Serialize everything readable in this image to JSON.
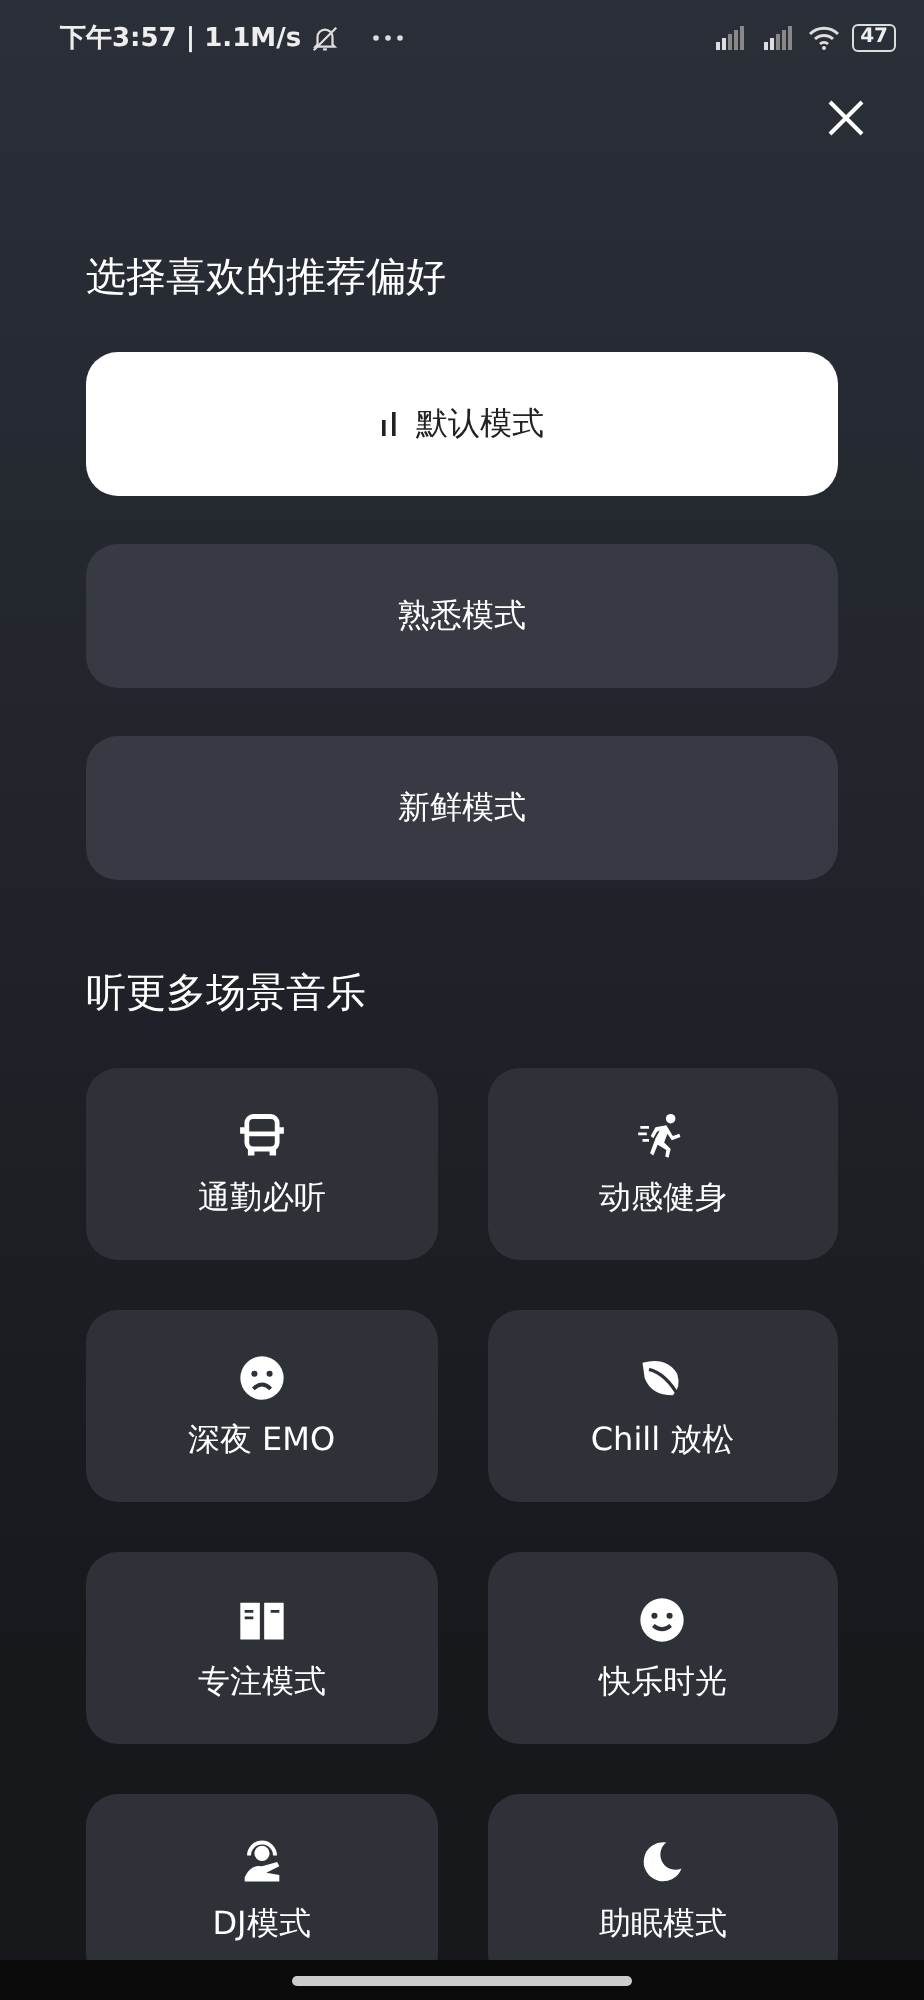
{
  "status_bar": {
    "time": "下午3:57 | 1.1M/s",
    "battery": "47"
  },
  "preference": {
    "title": "选择喜欢的推荐偏好",
    "options": [
      {
        "label": "默认模式",
        "selected": true
      },
      {
        "label": "熟悉模式",
        "selected": false
      },
      {
        "label": "新鲜模式",
        "selected": false
      }
    ]
  },
  "scenes": {
    "title": "听更多场景音乐",
    "items": [
      {
        "label": "通勤必听",
        "kind": "bus"
      },
      {
        "label": "动感健身",
        "kind": "runner"
      },
      {
        "label": "深夜 EMO",
        "kind": "sad"
      },
      {
        "label": "Chill 放松",
        "kind": "leaf"
      },
      {
        "label": "专注模式",
        "kind": "book"
      },
      {
        "label": "快乐时光",
        "kind": "smile"
      },
      {
        "label": "DJ模式",
        "kind": "dj"
      },
      {
        "label": "助眠模式",
        "kind": "moon"
      }
    ]
  }
}
